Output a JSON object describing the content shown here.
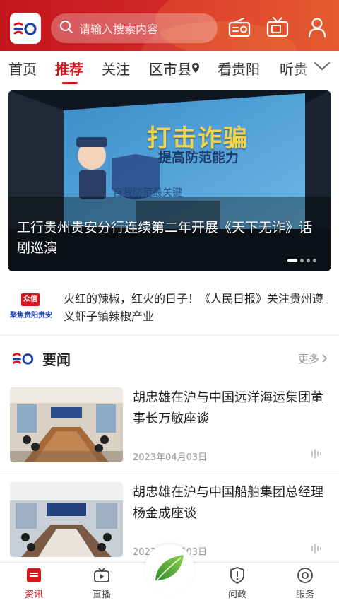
{
  "header": {
    "search_placeholder": "请输入搜索内容"
  },
  "nav": {
    "tabs": [
      {
        "label": "首页"
      },
      {
        "label": "推荐",
        "active": true
      },
      {
        "label": "关注"
      },
      {
        "label": "区市县"
      },
      {
        "label": "看贵阳"
      },
      {
        "label": "听贵"
      }
    ]
  },
  "banner": {
    "title": "工行贵州贵安分行连续第二年开展《天下无诈》话剧巡演",
    "screen_title": "打击诈骗",
    "screen_subtitle": "提高防范能力",
    "screen_slogan": "自我防范最关键",
    "slides": 4,
    "active_slide": 0
  },
  "notice": {
    "logo_top": "众信",
    "logo_bottom": "聚焦贵阳贵安",
    "text": "火红的辣椒，红火的日子！《人民日报》关注贵州遵义虾子镇辣椒产业"
  },
  "section": {
    "title": "要闻",
    "more": "更多"
  },
  "news": [
    {
      "title": "胡忠雄在沪与中国远洋海运集团董事长万敏座谈",
      "date": "2023年04月03日"
    },
    {
      "title": "胡忠雄在沪与中国船舶集团总经理杨金成座谈",
      "date": "2023年04月03日"
    }
  ],
  "bottom_nav": [
    {
      "label": "资讯",
      "icon": "news-icon",
      "active": true
    },
    {
      "label": "直播",
      "icon": "live-tv-icon"
    },
    {
      "label": "",
      "icon": "leaf-icon"
    },
    {
      "label": "问政",
      "icon": "shield-icon"
    },
    {
      "label": "服务",
      "icon": "service-icon"
    }
  ],
  "colors": {
    "brand_red": "#d7161d",
    "header_red": "#c3161c"
  }
}
